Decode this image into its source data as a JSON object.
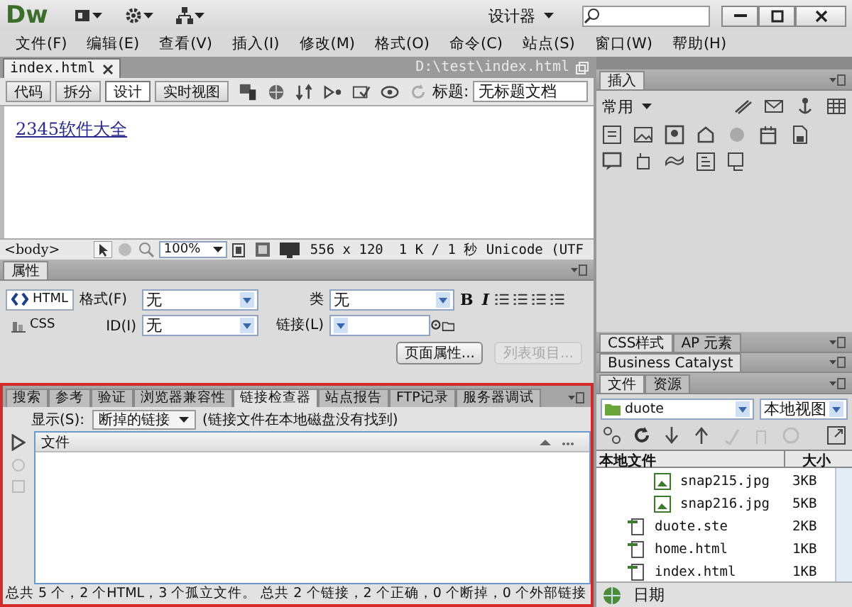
{
  "window": {
    "logo": "Dw",
    "workspace": "设计器"
  },
  "menu": [
    "文件(F)",
    "编辑(E)",
    "查看(V)",
    "插入(I)",
    "修改(M)",
    "格式(O)",
    "命令(C)",
    "站点(S)",
    "窗口(W)",
    "帮助(H)"
  ],
  "document": {
    "tabs": [
      {
        "label": "index.html",
        "selected": true
      }
    ],
    "path": "D:\\test\\index.html",
    "view_buttons": [
      {
        "label": "代码",
        "selected": false
      },
      {
        "label": "拆分",
        "selected": false
      },
      {
        "label": "设计",
        "selected": true
      },
      {
        "label": "实时视图",
        "selected": false
      }
    ],
    "title_label": "标题:",
    "title_value": "无标题文档",
    "content_link": "2345软件大全"
  },
  "status_bar": {
    "tag": "<body>",
    "zoom": "100%",
    "dimensions": "556 x 120",
    "info": "1 K / 1 秒 Unicode (UTF"
  },
  "properties": {
    "title": "属性",
    "modes": [
      {
        "label": "HTML",
        "selected": true
      },
      {
        "label": "CSS",
        "selected": false
      }
    ],
    "format": {
      "label": "格式(F)",
      "value": "无"
    },
    "id": {
      "label": "ID(I)",
      "value": "无"
    },
    "class": {
      "label": "类",
      "value": "无"
    },
    "link": {
      "label": "链接(L)"
    },
    "style_buttons": [
      "B",
      "I"
    ],
    "page_button": "页面属性...",
    "list_button": {
      "label": "列表项目...",
      "disabled": true
    }
  },
  "results": {
    "tabs": [
      {
        "label": "搜索",
        "selected": false
      },
      {
        "label": "参考",
        "selected": false
      },
      {
        "label": "验证",
        "selected": false
      },
      {
        "label": "浏览器兼容性",
        "selected": false
      },
      {
        "label": "链接检查器",
        "selected": true
      },
      {
        "label": "站点报告",
        "selected": false
      },
      {
        "label": "FTP记录",
        "selected": false
      },
      {
        "label": "服务器调试",
        "selected": false
      }
    ],
    "show_label": "显示(S):",
    "show_value": "断掉的链接",
    "note": "(链接文件在本地磁盘没有找到)",
    "column": "文件",
    "summary": "总共 5 个，2 个HTML，3 个孤立文件。 总共 2 个链接，2 个正确，0 个断掉，0 个外部链接"
  },
  "insert_panel": {
    "tab": "插入",
    "category": "常用"
  },
  "css_tabs": [
    {
      "label": "CSS样式",
      "selected": true
    },
    {
      "label": "AP 元素",
      "selected": false
    }
  ],
  "business_catalyst": "Business Catalyst",
  "files_panel": {
    "tabs": [
      {
        "label": "文件",
        "selected": true
      },
      {
        "label": "资源",
        "selected": false
      }
    ],
    "site": "duote",
    "view": "本地视图",
    "columns": [
      "本地文件",
      "大小"
    ],
    "files": [
      {
        "name": "snap215.jpg",
        "size": "3KB",
        "kind": "image"
      },
      {
        "name": "snap216.jpg",
        "size": "5KB",
        "kind": "image"
      },
      {
        "name": "duote.ste",
        "size": "2KB",
        "kind": "file"
      },
      {
        "name": "home.html",
        "size": "1KB",
        "kind": "file"
      },
      {
        "name": "index.html",
        "size": "1KB",
        "kind": "file"
      }
    ],
    "status": "日期"
  }
}
